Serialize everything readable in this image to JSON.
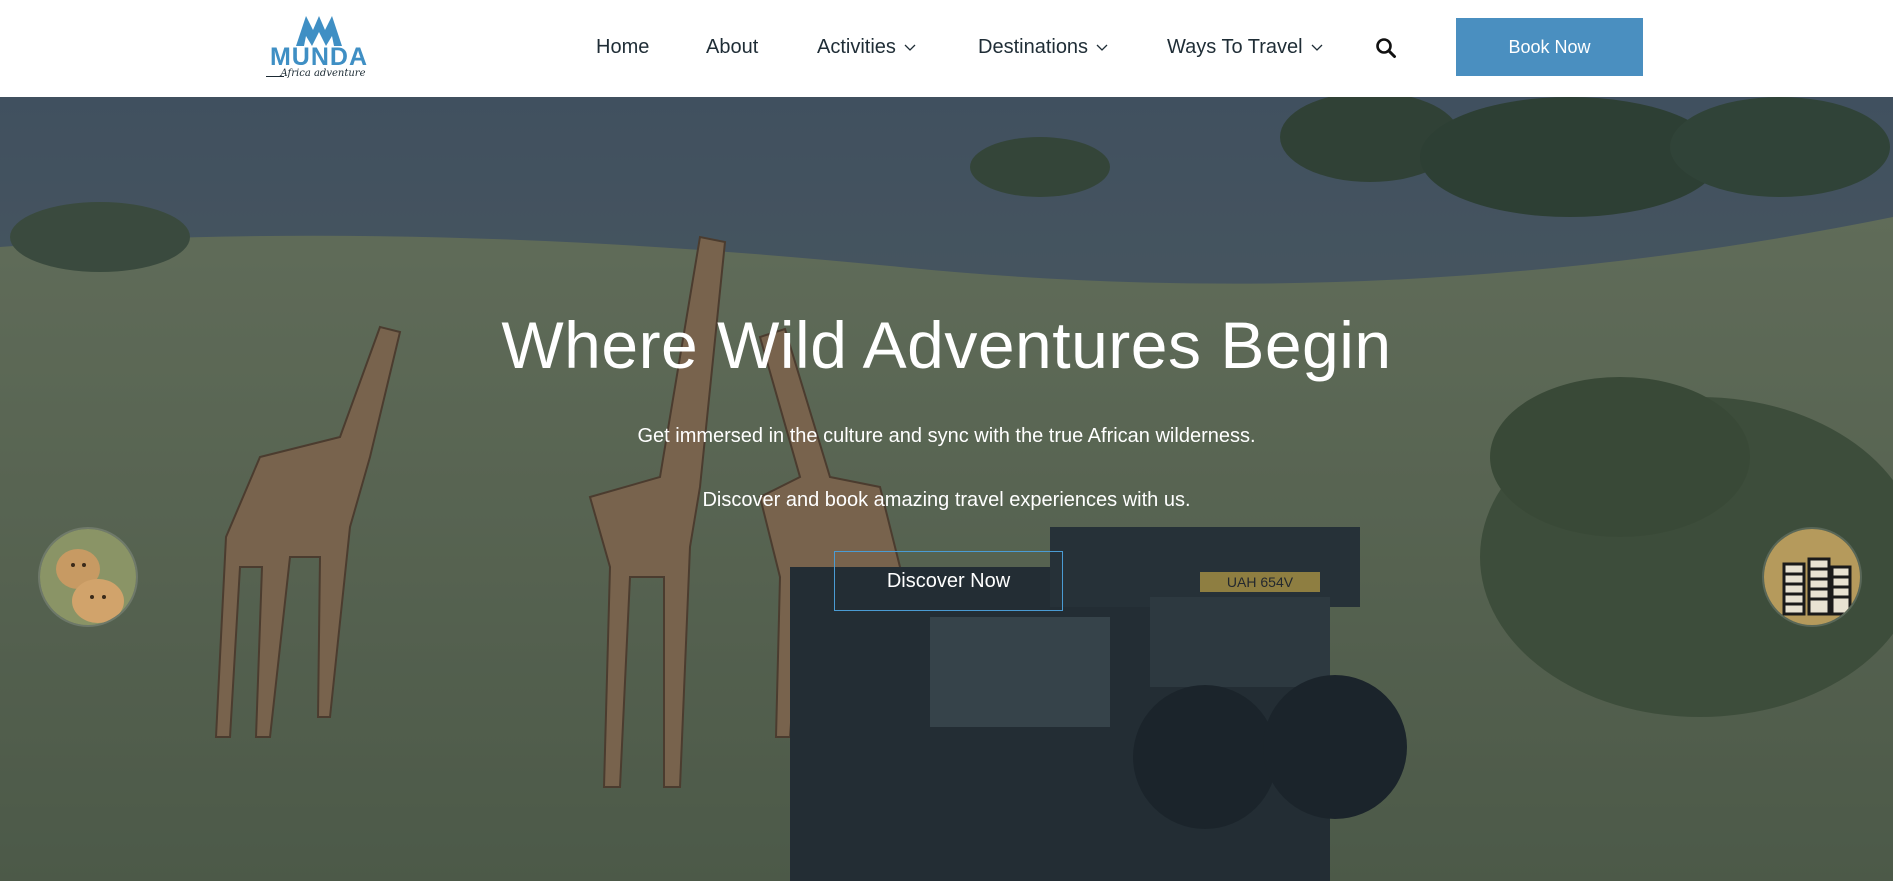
{
  "brand": {
    "name": "MUNDA",
    "tagline": "Africa adventure",
    "accent_color": "#4a8fc0",
    "logo_icon": "mountain-peaks-icon"
  },
  "nav": {
    "items": [
      {
        "label": "Home",
        "has_dropdown": false
      },
      {
        "label": "About",
        "has_dropdown": false
      },
      {
        "label": "Activities",
        "has_dropdown": true
      },
      {
        "label": "Destinations",
        "has_dropdown": true
      },
      {
        "label": "Ways To Travel",
        "has_dropdown": true
      }
    ],
    "search_icon": "search-icon",
    "cta_label": "Book Now"
  },
  "hero": {
    "title": "Where Wild Adventures Begin",
    "subtitle_1": "Get immersed in the culture and sync with the true African wilderness.",
    "subtitle_2": "Discover and book amazing travel experiences with us.",
    "cta_label": "Discover Now",
    "background": "giraffes-and-safari-vehicle-photo",
    "plate_text": "UAH 654V",
    "prev_slide_thumb": "lions-thumbnail",
    "next_slide_thumb": "zebras-thumbnail"
  }
}
